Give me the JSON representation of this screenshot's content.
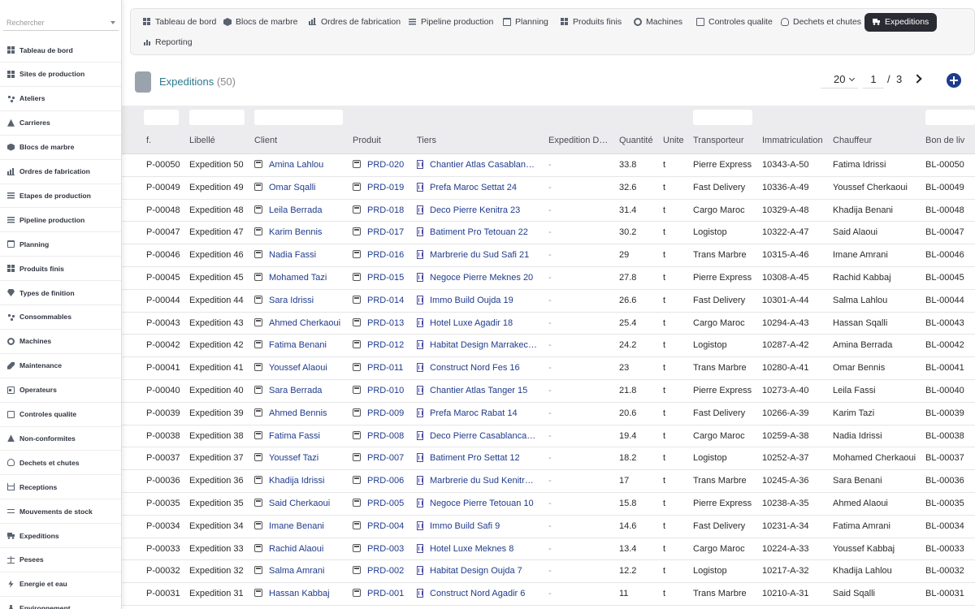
{
  "sidebar": {
    "search_placeholder": "Rechercher",
    "items": [
      {
        "label": "Tableau de bord",
        "icon": "grid-icon"
      },
      {
        "label": "Sites de production",
        "icon": "grid-icon"
      },
      {
        "label": "Ateliers",
        "icon": "network-icon"
      },
      {
        "label": "Carrieres",
        "icon": "mountain-icon"
      },
      {
        "label": "Blocs de marbre",
        "icon": "cube-icon"
      },
      {
        "label": "Ordres de fabrication",
        "icon": "factory-icon"
      },
      {
        "label": "Etapes de production",
        "icon": "list-icon"
      },
      {
        "label": "Pipeline production",
        "icon": "list-icon"
      },
      {
        "label": "Planning",
        "icon": "calendar-icon"
      },
      {
        "label": "Produits finis",
        "icon": "grid-icon"
      },
      {
        "label": "Types de finition",
        "icon": "gem-icon"
      },
      {
        "label": "Consommables",
        "icon": "network-icon"
      },
      {
        "label": "Machines",
        "icon": "gear-icon"
      },
      {
        "label": "Maintenance",
        "icon": "wrench-icon"
      },
      {
        "label": "Operateurs",
        "icon": "id-card-icon"
      },
      {
        "label": "Controles qualite",
        "icon": "clipboard-check-icon"
      },
      {
        "label": "Non-conformites",
        "icon": "warning-icon"
      },
      {
        "label": "Dechets et chutes",
        "icon": "recycle-icon"
      },
      {
        "label": "Receptions",
        "icon": "inbox-icon"
      },
      {
        "label": "Mouvements de stock",
        "icon": "arrows-icon"
      },
      {
        "label": "Expeditions",
        "icon": "truck-icon"
      },
      {
        "label": "Pesees",
        "icon": "scale-icon"
      },
      {
        "label": "Energie et eau",
        "icon": "bolt-icon"
      },
      {
        "label": "Environnement",
        "icon": "flask-icon"
      }
    ]
  },
  "topnav": {
    "items": [
      {
        "label": "Tableau de bord",
        "icon": "grid-icon"
      },
      {
        "label": "Blocs de marbre",
        "icon": "cube-icon"
      },
      {
        "label": "Ordres de fabrication",
        "icon": "factory-icon"
      },
      {
        "label": "Pipeline production",
        "icon": "list-icon"
      },
      {
        "label": "Planning",
        "icon": "calendar-icon"
      },
      {
        "label": "Produits finis",
        "icon": "grid-icon"
      },
      {
        "label": "Machines",
        "icon": "gear-icon"
      },
      {
        "label": "Controles qualite",
        "icon": "clipboard-check-icon"
      },
      {
        "label": "Dechets et chutes",
        "icon": "recycle-icon"
      },
      {
        "label": "Expeditions",
        "icon": "truck-icon",
        "active": true
      },
      {
        "label": "Reporting",
        "icon": "chart-icon"
      }
    ]
  },
  "page": {
    "title": "Expeditions",
    "count": "(50)"
  },
  "pager": {
    "page_size": "20",
    "current_page": "1",
    "separator": "/",
    "total_pages": "3"
  },
  "table": {
    "headers": [
      "f.",
      "Libellé",
      "Client",
      "Produit",
      "Tiers",
      "Expedition D…",
      "Quantité",
      "Unite",
      "Transporteur",
      "Immatriculation",
      "Chauffeur",
      "Bon de liv"
    ],
    "rows": [
      {
        "ref": "P-00050",
        "libelle": "Expedition 50",
        "client": "Amina Lahlou",
        "produit": "PRD-020",
        "tiers": "Chantier Atlas Casablan…",
        "date": "-",
        "quantite": "33.8",
        "unite": "t",
        "transporteur": "Pierre Express",
        "immat": "10343-A-50",
        "chauffeur": "Fatima Idrissi",
        "bon": "BL-00050"
      },
      {
        "ref": "P-00049",
        "libelle": "Expedition 49",
        "client": "Omar Sqalli",
        "produit": "PRD-019",
        "tiers": "Prefa Maroc Settat 24",
        "date": "-",
        "quantite": "32.6",
        "unite": "t",
        "transporteur": "Fast Delivery",
        "immat": "10336-A-49",
        "chauffeur": "Youssef Cherkaoui",
        "bon": "BL-00049"
      },
      {
        "ref": "P-00048",
        "libelle": "Expedition 48",
        "client": "Leila Berrada",
        "produit": "PRD-018",
        "tiers": "Deco Pierre Kenitra 23",
        "date": "-",
        "quantite": "31.4",
        "unite": "t",
        "transporteur": "Cargo Maroc",
        "immat": "10329-A-48",
        "chauffeur": "Khadija Benani",
        "bon": "BL-00048"
      },
      {
        "ref": "P-00047",
        "libelle": "Expedition 47",
        "client": "Karim Bennis",
        "produit": "PRD-017",
        "tiers": "Batiment Pro Tetouan 22",
        "date": "-",
        "quantite": "30.2",
        "unite": "t",
        "transporteur": "Logistop",
        "immat": "10322-A-47",
        "chauffeur": "Said Alaoui",
        "bon": "BL-00047"
      },
      {
        "ref": "P-00046",
        "libelle": "Expedition 46",
        "client": "Nadia Fassi",
        "produit": "PRD-016",
        "tiers": "Marbrerie du Sud Safi 21",
        "date": "-",
        "quantite": "29",
        "unite": "t",
        "transporteur": "Trans Marbre",
        "immat": "10315-A-46",
        "chauffeur": "Imane Amrani",
        "bon": "BL-00046"
      },
      {
        "ref": "P-00045",
        "libelle": "Expedition 45",
        "client": "Mohamed Tazi",
        "produit": "PRD-015",
        "tiers": "Negoce Pierre Meknes 20",
        "date": "-",
        "quantite": "27.8",
        "unite": "t",
        "transporteur": "Pierre Express",
        "immat": "10308-A-45",
        "chauffeur": "Rachid Kabbaj",
        "bon": "BL-00045"
      },
      {
        "ref": "P-00044",
        "libelle": "Expedition 44",
        "client": "Sara Idrissi",
        "produit": "PRD-014",
        "tiers": "Immo Build Oujda 19",
        "date": "-",
        "quantite": "26.6",
        "unite": "t",
        "transporteur": "Fast Delivery",
        "immat": "10301-A-44",
        "chauffeur": "Salma Lahlou",
        "bon": "BL-00044"
      },
      {
        "ref": "P-00043",
        "libelle": "Expedition 43",
        "client": "Ahmed Cherkaoui",
        "produit": "PRD-013",
        "tiers": "Hotel Luxe Agadir 18",
        "date": "-",
        "quantite": "25.4",
        "unite": "t",
        "transporteur": "Cargo Maroc",
        "immat": "10294-A-43",
        "chauffeur": "Hassan Sqalli",
        "bon": "BL-00043"
      },
      {
        "ref": "P-00042",
        "libelle": "Expedition 42",
        "client": "Fatima Benani",
        "produit": "PRD-012",
        "tiers": "Habitat Design Marrakec…",
        "date": "-",
        "quantite": "24.2",
        "unite": "t",
        "transporteur": "Logistop",
        "immat": "10287-A-42",
        "chauffeur": "Amina Berrada",
        "bon": "BL-00042"
      },
      {
        "ref": "P-00041",
        "libelle": "Expedition 41",
        "client": "Youssef Alaoui",
        "produit": "PRD-011",
        "tiers": "Construct Nord Fes 16",
        "date": "-",
        "quantite": "23",
        "unite": "t",
        "transporteur": "Trans Marbre",
        "immat": "10280-A-41",
        "chauffeur": "Omar Bennis",
        "bon": "BL-00041"
      },
      {
        "ref": "P-00040",
        "libelle": "Expedition 40",
        "client": "Sara Berrada",
        "produit": "PRD-010",
        "tiers": "Chantier Atlas Tanger 15",
        "date": "-",
        "quantite": "21.8",
        "unite": "t",
        "transporteur": "Pierre Express",
        "immat": "10273-A-40",
        "chauffeur": "Leila Fassi",
        "bon": "BL-00040"
      },
      {
        "ref": "P-00039",
        "libelle": "Expedition 39",
        "client": "Ahmed Bennis",
        "produit": "PRD-009",
        "tiers": "Prefa Maroc Rabat 14",
        "date": "-",
        "quantite": "20.6",
        "unite": "t",
        "transporteur": "Fast Delivery",
        "immat": "10266-A-39",
        "chauffeur": "Karim Tazi",
        "bon": "BL-00039"
      },
      {
        "ref": "P-00038",
        "libelle": "Expedition 38",
        "client": "Fatima Fassi",
        "produit": "PRD-008",
        "tiers": "Deco Pierre Casablanca…",
        "date": "-",
        "quantite": "19.4",
        "unite": "t",
        "transporteur": "Cargo Maroc",
        "immat": "10259-A-38",
        "chauffeur": "Nadia Idrissi",
        "bon": "BL-00038"
      },
      {
        "ref": "P-00037",
        "libelle": "Expedition 37",
        "client": "Youssef Tazi",
        "produit": "PRD-007",
        "tiers": "Batiment Pro Settat 12",
        "date": "-",
        "quantite": "18.2",
        "unite": "t",
        "transporteur": "Logistop",
        "immat": "10252-A-37",
        "chauffeur": "Mohamed Cherkaoui",
        "bon": "BL-00037"
      },
      {
        "ref": "P-00036",
        "libelle": "Expedition 36",
        "client": "Khadija Idrissi",
        "produit": "PRD-006",
        "tiers": "Marbrerie du Sud Kenitr…",
        "date": "-",
        "quantite": "17",
        "unite": "t",
        "transporteur": "Trans Marbre",
        "immat": "10245-A-36",
        "chauffeur": "Sara Benani",
        "bon": "BL-00036"
      },
      {
        "ref": "P-00035",
        "libelle": "Expedition 35",
        "client": "Said Cherkaoui",
        "produit": "PRD-005",
        "tiers": "Negoce Pierre Tetouan 10",
        "date": "-",
        "quantite": "15.8",
        "unite": "t",
        "transporteur": "Pierre Express",
        "immat": "10238-A-35",
        "chauffeur": "Ahmed Alaoui",
        "bon": "BL-00035"
      },
      {
        "ref": "P-00034",
        "libelle": "Expedition 34",
        "client": "Imane Benani",
        "produit": "PRD-004",
        "tiers": "Immo Build Safi 9",
        "date": "-",
        "quantite": "14.6",
        "unite": "t",
        "transporteur": "Fast Delivery",
        "immat": "10231-A-34",
        "chauffeur": "Fatima Amrani",
        "bon": "BL-00034"
      },
      {
        "ref": "P-00033",
        "libelle": "Expedition 33",
        "client": "Rachid Alaoui",
        "produit": "PRD-003",
        "tiers": "Hotel Luxe Meknes 8",
        "date": "-",
        "quantite": "13.4",
        "unite": "t",
        "transporteur": "Cargo Maroc",
        "immat": "10224-A-33",
        "chauffeur": "Youssef Kabbaj",
        "bon": "BL-00033"
      },
      {
        "ref": "P-00032",
        "libelle": "Expedition 32",
        "client": "Salma Amrani",
        "produit": "PRD-002",
        "tiers": "Habitat Design Oujda 7",
        "date": "-",
        "quantite": "12.2",
        "unite": "t",
        "transporteur": "Logistop",
        "immat": "10217-A-32",
        "chauffeur": "Khadija Lahlou",
        "bon": "BL-00032"
      },
      {
        "ref": "P-00031",
        "libelle": "Expedition 31",
        "client": "Hassan Kabbaj",
        "produit": "PRD-001",
        "tiers": "Construct Nord Agadir 6",
        "date": "-",
        "quantite": "11",
        "unite": "t",
        "transporteur": "Trans Marbre",
        "immat": "10210-A-31",
        "chauffeur": "Said Sqalli",
        "bon": "BL-00031"
      }
    ]
  }
}
